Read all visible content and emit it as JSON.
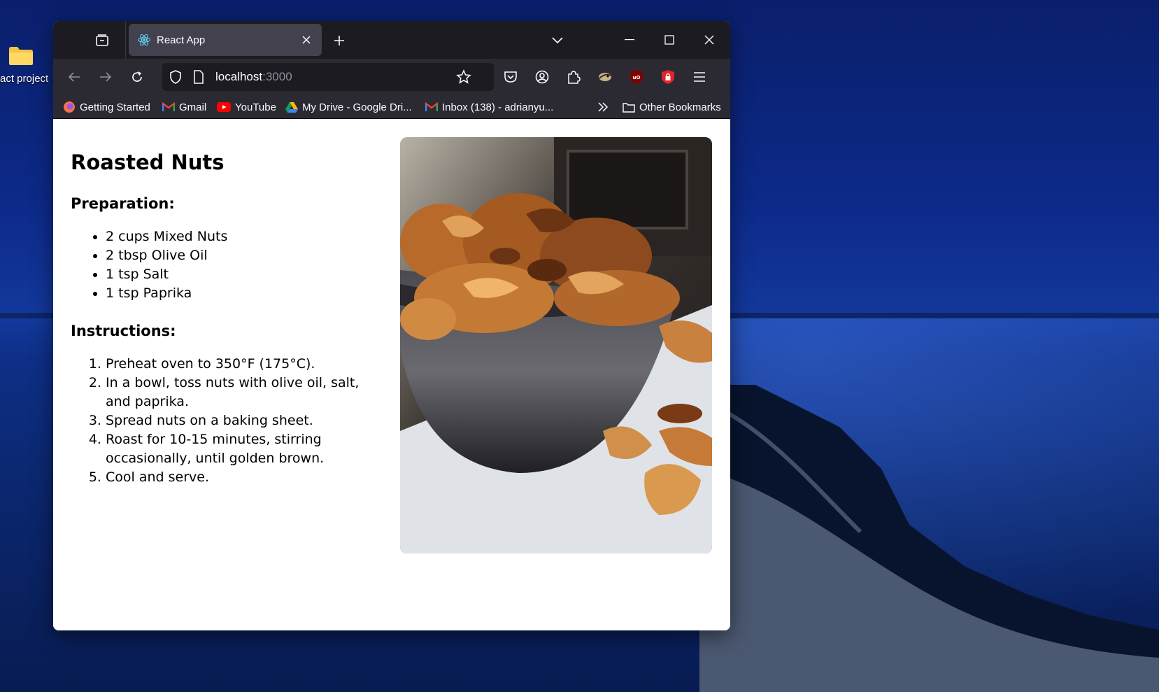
{
  "desktop": {
    "folder_label": "act project"
  },
  "browser": {
    "tab_title": "React App",
    "url_host": "localhost",
    "url_port": ":3000",
    "bookmarks": [
      {
        "label": "Getting Started",
        "icon": "firefox-icon"
      },
      {
        "label": "Gmail",
        "icon": "gmail-icon"
      },
      {
        "label": "YouTube",
        "icon": "youtube-icon"
      },
      {
        "label": "My Drive - Google Dri...",
        "icon": "google-drive-icon"
      },
      {
        "label": "Inbox (138) - adrianyu...",
        "icon": "gmail-icon"
      }
    ],
    "other_bookmarks": "Other Bookmarks"
  },
  "recipe": {
    "title": "Roasted Nuts",
    "preparation_heading": "Preparation:",
    "ingredients": [
      "2 cups Mixed Nuts",
      "2 tbsp Olive Oil",
      "1 tsp Salt",
      "1 tsp Paprika"
    ],
    "instructions_heading": "Instructions:",
    "steps": [
      "Preheat oven to 350°F (175°C).",
      "In a bowl, toss nuts with olive oil, salt, and paprika.",
      "Spread nuts on a baking sheet.",
      "Roast for 10-15 minutes, stirring occasionally, until golden brown.",
      "Cool and serve."
    ]
  },
  "colors": {
    "tab_bar": "#1c1b22",
    "toolbar": "#2b2a33",
    "active_tab": "#42414d"
  }
}
